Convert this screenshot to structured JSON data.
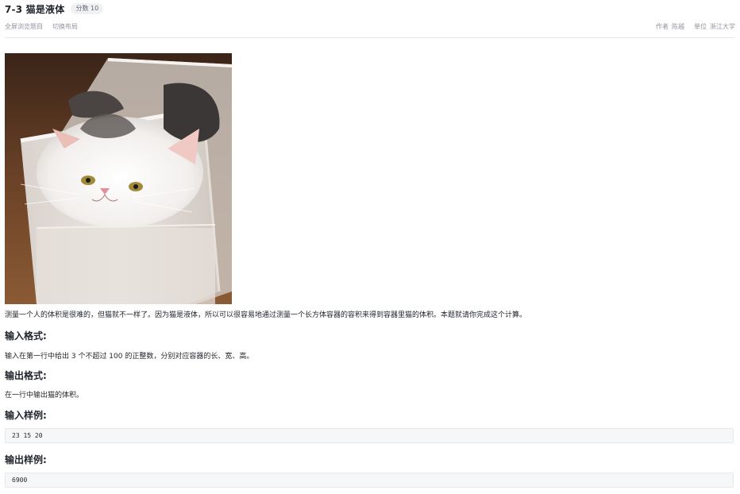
{
  "header": {
    "title": "7-3 猫是液体",
    "score_badge": "分数 10",
    "links": {
      "fullscreen": "全屏浏览题目",
      "switch_layout": "切换布局"
    },
    "meta": {
      "author_label": "作者",
      "author_value": "陈越",
      "unit_label": "单位",
      "unit_value": "浙江大学"
    }
  },
  "problem": {
    "description": "测量一个人的体积是很难的，但猫就不一样了。因为猫是液体，所以可以很容易地通过测量一个长方体容器的容积来得到容器里猫的体积。本题就请你完成这个计算。",
    "input_format_title": "输入格式:",
    "input_format_text": "输入在第一行中给出 3 个不超过 100 的正整数，分别对应容器的长、宽、高。",
    "output_format_title": "输出格式:",
    "output_format_text": "在一行中输出猫的体积。",
    "input_sample_title": "输入样例:",
    "input_sample": "23 15 20",
    "output_sample_title": "输出样例:",
    "output_sample": "6900"
  },
  "colors": {
    "text": "#1f2329",
    "muted": "#8f959e",
    "badge_bg": "#f0f1f3",
    "code_bg": "#f6f7f8"
  }
}
